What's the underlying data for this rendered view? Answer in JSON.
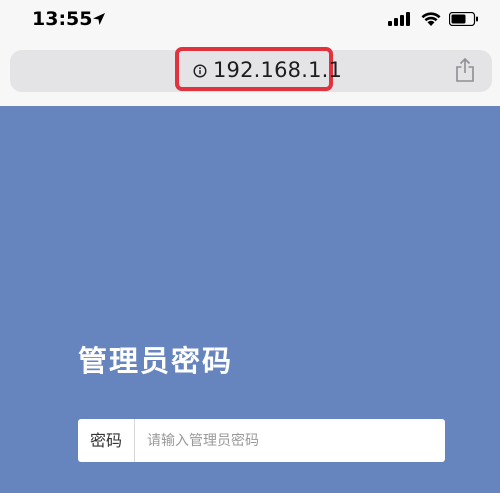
{
  "status_bar": {
    "time": "13:55"
  },
  "browser": {
    "url": "192.168.1.1",
    "highlight_color": "#e2323d"
  },
  "login": {
    "title": "管理员密码",
    "password_label": "密码",
    "password_placeholder": "请输入管理员密码",
    "password_value": ""
  },
  "colors": {
    "page_background": "#6684bd",
    "toolbar_background": "#f7f7f7"
  },
  "icons": [
    "location-arrow-icon",
    "cellular-signal-icon",
    "wifi-icon",
    "battery-icon",
    "info-icon",
    "share-icon"
  ]
}
